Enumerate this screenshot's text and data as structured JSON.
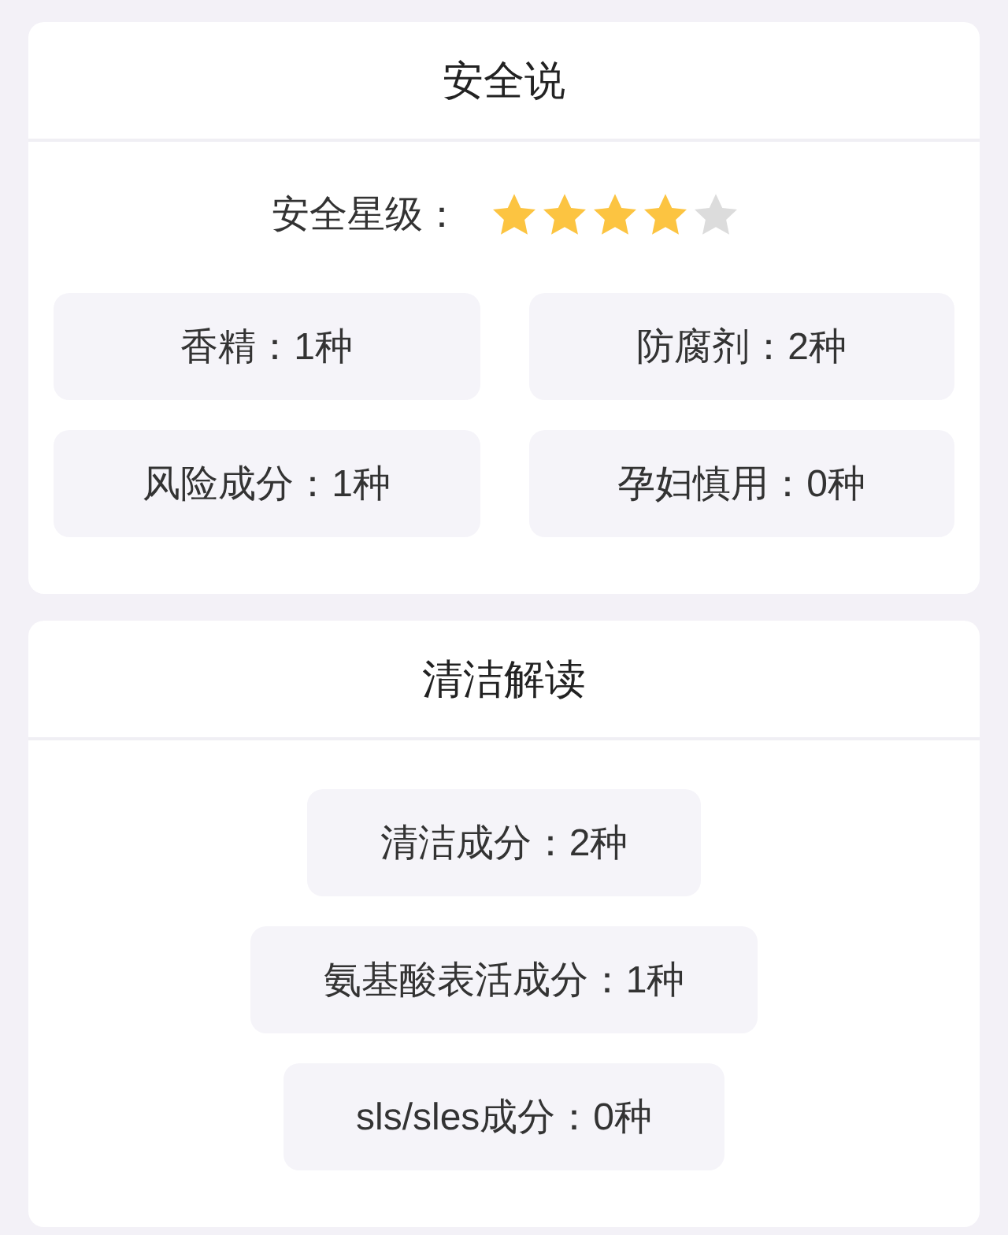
{
  "sections": [
    {
      "kind": "grid",
      "title": "安全说",
      "rating": {
        "label": "安全星级：",
        "stars": 4
      },
      "stats": [
        "香精：1种",
        "防腐剂：2种",
        "风险成分：1种",
        "孕妇慎用：0种"
      ]
    },
    {
      "kind": "list",
      "title": "清洁解读",
      "stats": [
        "清洁成分：2种",
        "氨基酸表活成分：1种",
        "sls/sles成分：0种"
      ]
    }
  ]
}
